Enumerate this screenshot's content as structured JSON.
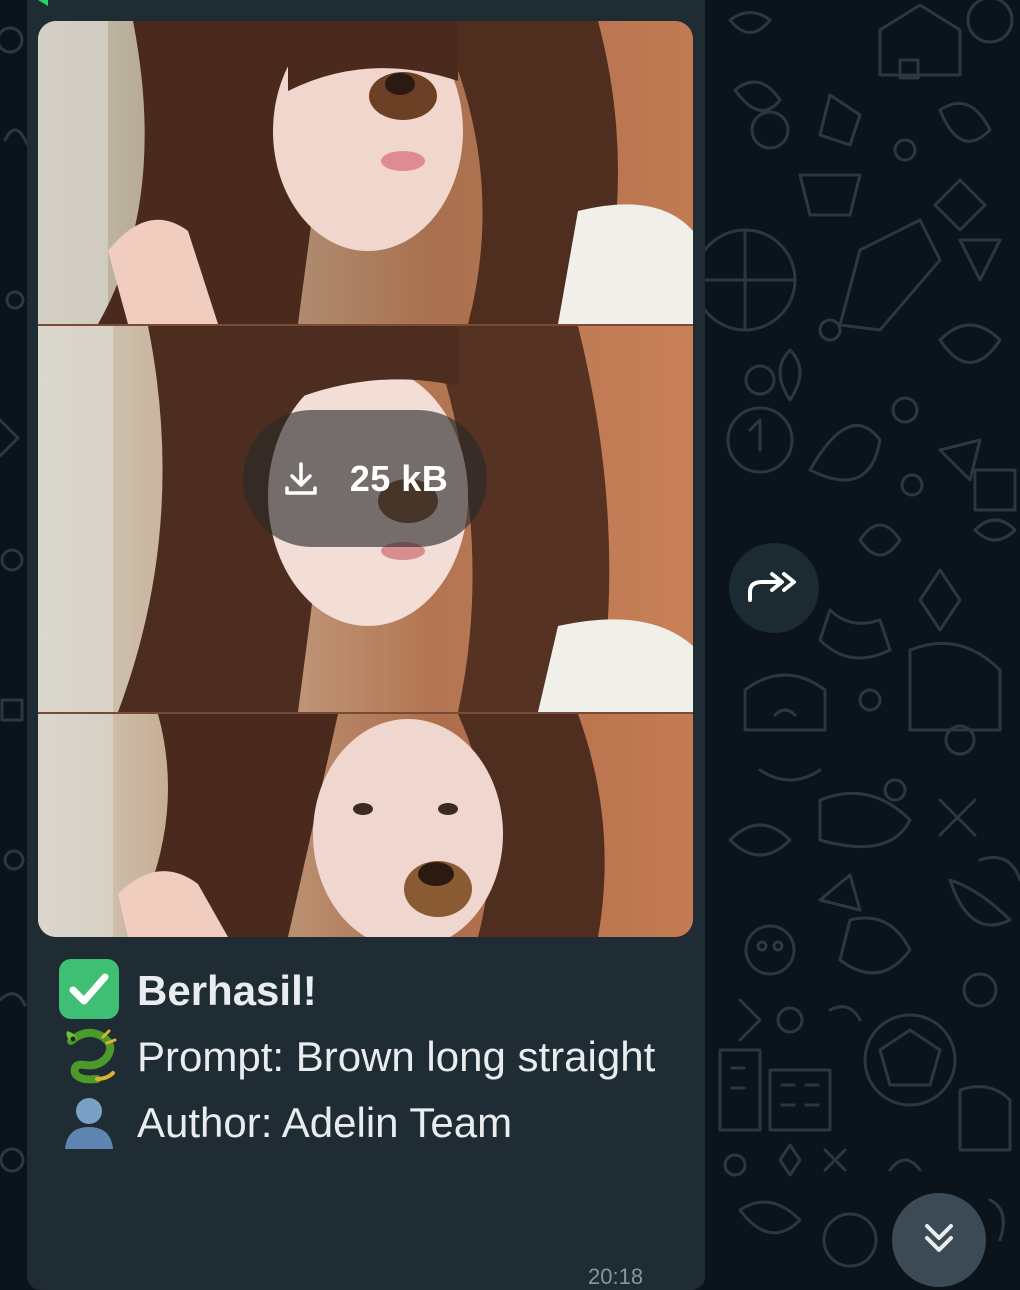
{
  "media": {
    "download_size": "25 kB"
  },
  "caption": {
    "title": "Berhasil!",
    "prompt": "Prompt: Brown long straight",
    "author": "Author: Adelin Team",
    "title_emoji": "check-mark-button",
    "prompt_emoji": "dragon",
    "author_emoji": "bust-in-silhouette"
  },
  "message": {
    "time_partial": "20:18"
  },
  "icons": {
    "forward": "forward-arrow-icon",
    "scroll_down": "double-chevron-down-icon",
    "download": "download-icon"
  },
  "colors": {
    "chat_background": "#0b141a",
    "bubble": "#202c33",
    "text": "#e9edef",
    "muted": "#8696a0",
    "check_green": "#3fbf74"
  }
}
